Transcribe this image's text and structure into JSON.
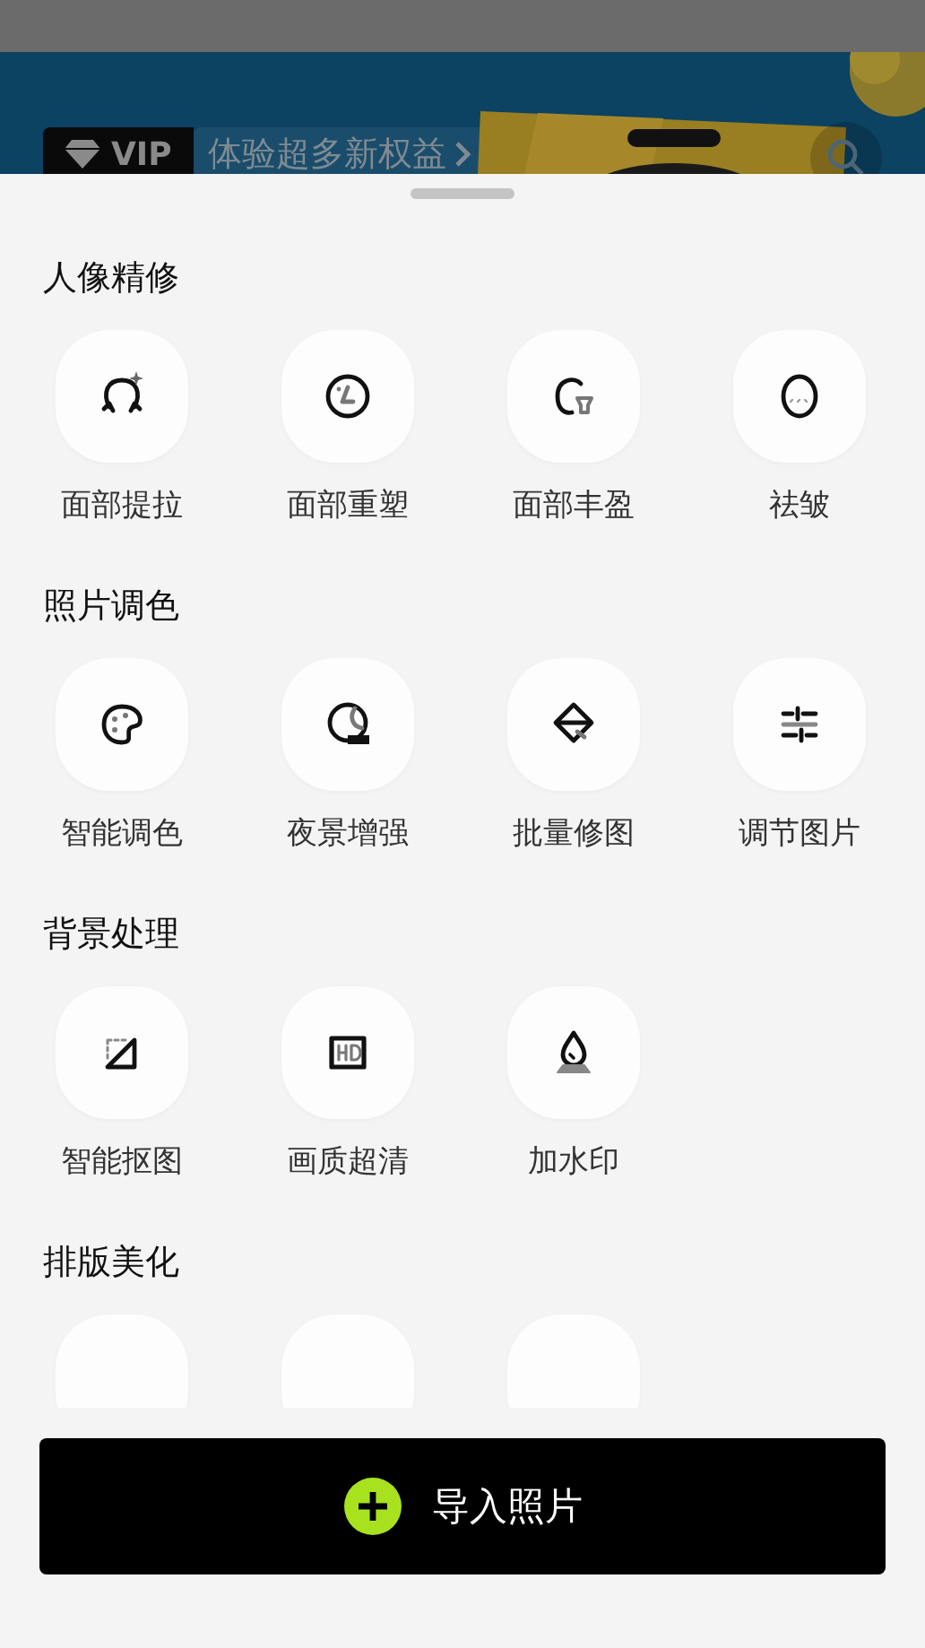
{
  "banner": {
    "vip_badge": "VIP",
    "promo_link": "体验超多新权益"
  },
  "sheet": {
    "sections": [
      {
        "title": "人像精修",
        "items": [
          {
            "kind": "tool",
            "label": "面部提拉"
          },
          {
            "kind": "tool",
            "label": "面部重塑"
          },
          {
            "kind": "tool",
            "label": "面部丰盈"
          },
          {
            "kind": "tool",
            "label": "祛皱"
          }
        ]
      },
      {
        "title": "照片调色",
        "items": [
          {
            "kind": "tool",
            "label": "智能调色"
          },
          {
            "kind": "tool",
            "label": "夜景增强"
          },
          {
            "kind": "tool",
            "label": "批量修图"
          },
          {
            "kind": "tool",
            "label": "调节图片"
          }
        ]
      },
      {
        "title": "背景处理",
        "items": [
          {
            "kind": "tool",
            "label": "智能抠图"
          },
          {
            "kind": "tool",
            "label": "画质超清"
          },
          {
            "kind": "tool",
            "label": "加水印"
          }
        ]
      },
      {
        "title": "排版美化",
        "items": [
          {
            "kind": "cut_off"
          },
          {
            "kind": "cut_off"
          },
          {
            "kind": "cut_off"
          }
        ]
      }
    ]
  },
  "import_button": {
    "label": "导入照片"
  }
}
